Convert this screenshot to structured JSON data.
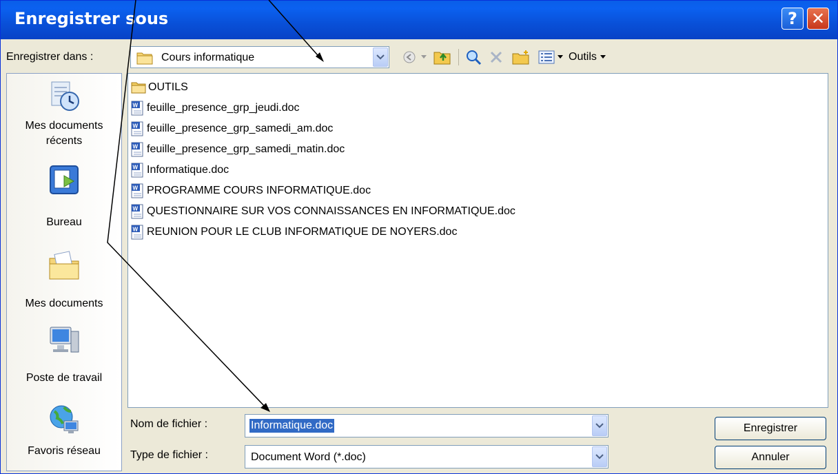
{
  "window": {
    "title": "Enregistrer sous",
    "help_label": "?",
    "close_label": "✕"
  },
  "toolbar": {
    "save_in_label": "Enregistrer dans :",
    "save_in_value": "Cours informatique",
    "tools_label": "Outils"
  },
  "places": [
    {
      "label": "Mes documents récents",
      "icon": "recent-documents-icon"
    },
    {
      "label": "Bureau",
      "icon": "desktop-icon"
    },
    {
      "label": "Mes documents",
      "icon": "my-documents-icon"
    },
    {
      "label": "Poste de travail",
      "icon": "my-computer-icon"
    },
    {
      "label": "Favoris réseau",
      "icon": "network-places-icon"
    }
  ],
  "files": [
    {
      "name": "OUTILS",
      "type": "folder"
    },
    {
      "name": "feuille_presence_grp_jeudi.doc",
      "type": "word"
    },
    {
      "name": "feuille_presence_grp_samedi_am.doc",
      "type": "word"
    },
    {
      "name": "feuille_presence_grp_samedi_matin.doc",
      "type": "word"
    },
    {
      "name": "Informatique.doc",
      "type": "word"
    },
    {
      "name": "PROGRAMME COURS INFORMATIQUE.doc",
      "type": "word"
    },
    {
      "name": "QUESTIONNAIRE SUR VOS CONNAISSANCES EN INFORMATIQUE.doc",
      "type": "word"
    },
    {
      "name": "REUNION POUR LE CLUB INFORMATIQUE DE NOYERS.doc",
      "type": "word"
    }
  ],
  "form": {
    "filename_label": "Nom de fichier :",
    "filename_value": "Informatique.doc",
    "filetype_label": "Type de fichier :",
    "filetype_value": "Document Word (*.doc)"
  },
  "buttons": {
    "save": "Enregistrer",
    "cancel": "Annuler"
  },
  "colors": {
    "titlebar": "#0a5ee8",
    "selection": "#316ac5",
    "dialog_bg": "#ece9d8"
  }
}
